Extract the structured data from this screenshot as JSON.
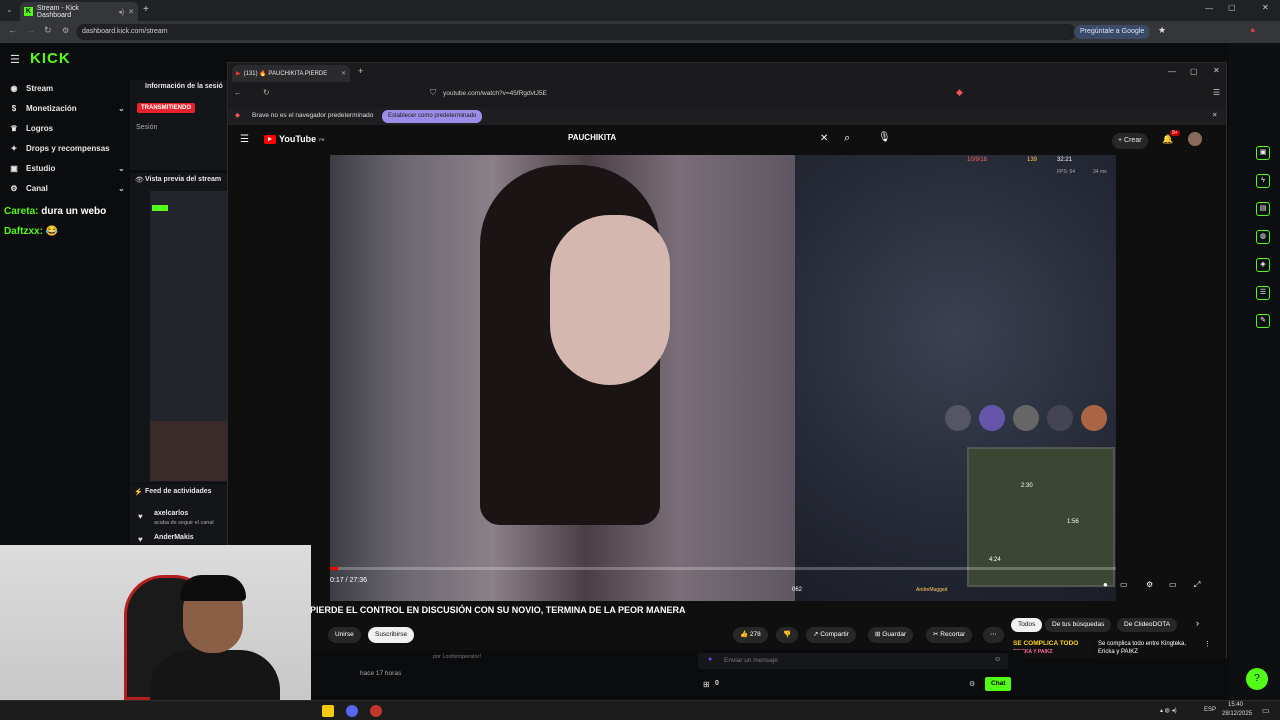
{
  "outer_browser": {
    "tab_title": "Stream - Kick Dashboard",
    "url": "dashboard.kick.com/stream",
    "ask_google": "Pregúntale a Google"
  },
  "kick": {
    "logo": "KICK",
    "sidebar": [
      {
        "label": "Stream",
        "icon": "stream-icon"
      },
      {
        "label": "Monetización",
        "icon": "money-icon",
        "chevron": true
      },
      {
        "label": "Logros",
        "icon": "trophy-icon"
      },
      {
        "label": "Drops y recompensas",
        "icon": "gift-icon"
      },
      {
        "label": "Estudio",
        "icon": "studio-icon",
        "chevron": true
      },
      {
        "label": "Canal",
        "icon": "channel-icon",
        "chevron": true
      }
    ],
    "chat_lines": [
      {
        "user": "Careta:",
        "text": "dura un webo"
      },
      {
        "user": "Daftzxx:",
        "text": "😂"
      }
    ],
    "session_info_title": "Información de la sesió",
    "live_badge": "TRANSMITIENDO",
    "session_label": "Sesión",
    "preview_title": "Vista previa del stream",
    "activity_title": "Feed de actividades",
    "activity": [
      {
        "user": "axelcarlos",
        "text": "acaba de seguir el canal"
      },
      {
        "user": "AnderMakis",
        "text": ""
      }
    ]
  },
  "inner_browser": {
    "tab_title": "(131) 🔥 PAUCHIKITA PIERDE",
    "url": "youtube.com/watch?v=45fRgdvtJ5E",
    "infobar_text": "Brave no es el navegador predeterminado",
    "set_default": "Establecer como predeterminado"
  },
  "youtube": {
    "logo": "YouTube",
    "logo_country": "PE",
    "search_value": "PAUCHIKITA",
    "create_label": "Crear",
    "notif_count": "9+",
    "video_title": "PIERDE EL CONTROL EN DISCUSIÓN CON SU NOVIO, TERMINA DE LA PEOR MANERA",
    "time_current": "0:17",
    "time_total": "27:36",
    "progress": 0.01,
    "join_label": "Unirse",
    "subscribe_label": "Suscribirse",
    "likes": "278",
    "share_label": "Compartir",
    "save_label": "Guardar",
    "clip_label": "Recortar",
    "chips": [
      "Todos",
      "De tus búsquedas",
      "De ClideoDOTA"
    ],
    "rec_title": "SE COMPLICA TODO",
    "rec_subtitle": "ERICKA Y PAIKZ",
    "rec_text": "Se complica todo entre Kingteka, Ericka y PAIKZ",
    "comment_time": "hace 17 horas",
    "comment_by": "por Lordsimperator!",
    "chat_placeholder": "Enviar un mensaje",
    "chat_count": "0",
    "chat_button": "Chat",
    "hud": {
      "kda": "10/9/18",
      "cs": "139",
      "clock": "32:21",
      "fps": "FPS: 64",
      "ping": "34 ms",
      "map_t1": "2:30",
      "map_t2": "1:56",
      "map_t3": "4:24",
      "minions": "062",
      "player": "AndreMugged"
    }
  },
  "taskbar": {
    "lang": "ESP",
    "time": "15:40",
    "date": "28/12/2025"
  },
  "colors": {
    "kick_green": "#53fc18",
    "yt_red": "#ff0000",
    "live_red": "#e8222c"
  }
}
